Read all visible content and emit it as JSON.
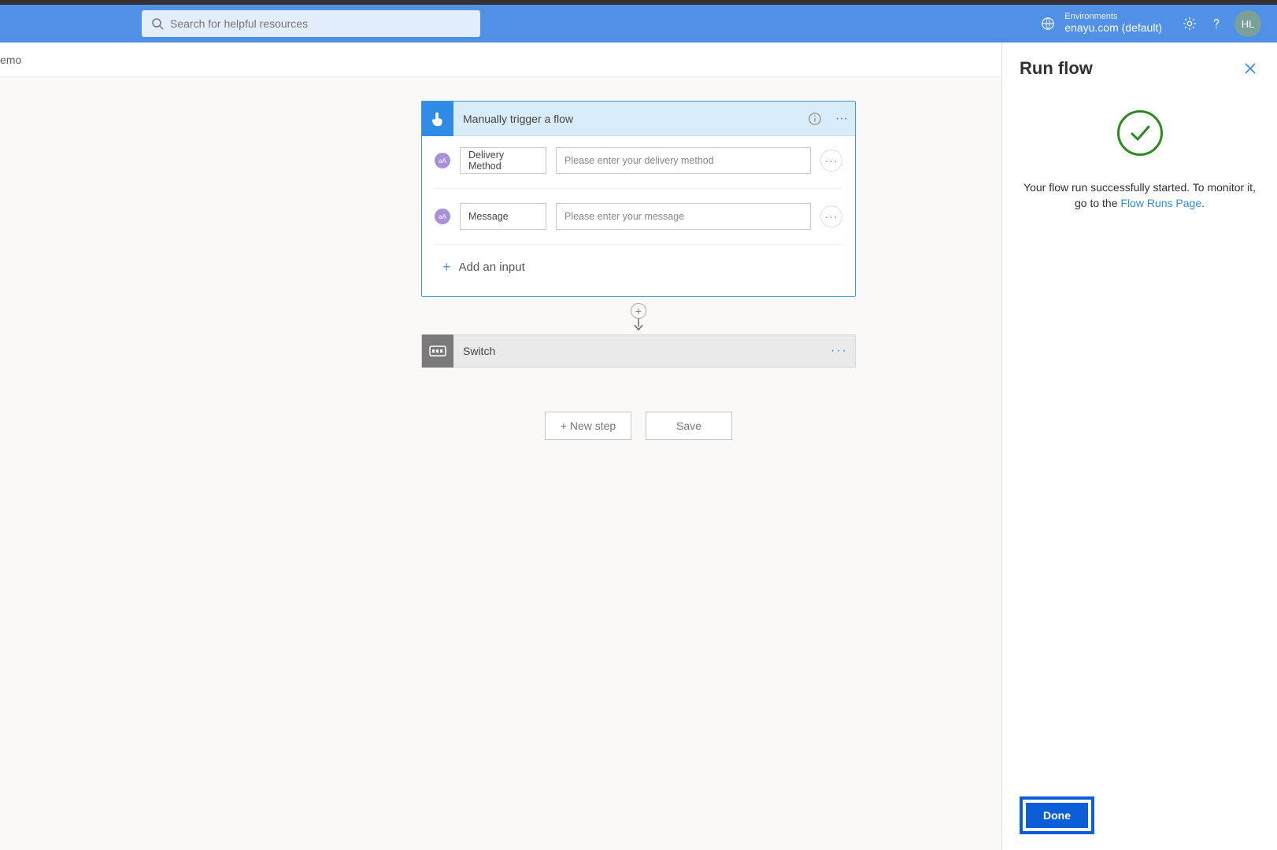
{
  "header": {
    "search_placeholder": "Search for helpful resources",
    "env_label": "Environments",
    "env_value": "enayu.com (default)",
    "avatar_initials": "HL"
  },
  "breadcrumb": {
    "text": "emo"
  },
  "trigger_card": {
    "title": "Manually trigger a flow",
    "inputs": [
      {
        "label": "Delivery Method",
        "placeholder": "Please enter your delivery method"
      },
      {
        "label": "Message",
        "placeholder": "Please enter your message"
      }
    ],
    "add_input_label": "Add an input"
  },
  "switch_card": {
    "title": "Switch"
  },
  "bottom": {
    "new_step": "+ New step",
    "save": "Save"
  },
  "panel": {
    "title": "Run flow",
    "message_prefix": "Your flow run successfully started. To monitor it, go to the ",
    "message_link": "Flow Runs Page",
    "message_suffix": ".",
    "done": "Done"
  }
}
